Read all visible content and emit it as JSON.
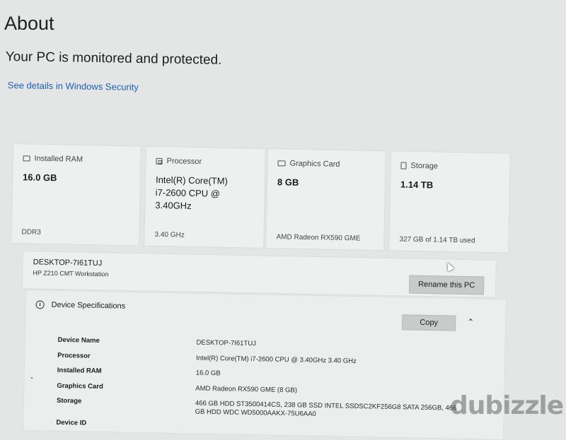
{
  "about": {
    "title": "About",
    "protection_status": "Your PC is monitored and protected.",
    "security_link": "See details in Windows Security"
  },
  "cards": {
    "ram": {
      "label": "Installed RAM",
      "value": "16.0 GB",
      "detail": "DDR3",
      "icon": "ram-icon"
    },
    "processor": {
      "label": "Processor",
      "value_lines": [
        "Intel(R) Core(TM)",
        "i7-2600 CPU @",
        "3.40GHz"
      ],
      "detail": "3.40 GHz",
      "icon": "processor-icon"
    },
    "graphics": {
      "label": "Graphics Card",
      "value": "8 GB",
      "detail": "AMD Radeon RX590 GME",
      "icon": "graphics-card-icon"
    },
    "storage": {
      "label": "Storage",
      "value": "1.14 TB",
      "detail": "327 GB of 1.14 TB used",
      "icon": "storage-icon"
    }
  },
  "device": {
    "name": "DESKTOP-7I61TUJ",
    "model": "HP Z210 CMT Workstation",
    "rename_button": "Rename this PC"
  },
  "specs": {
    "heading": "Device Specifications",
    "copy_button": "Copy",
    "rows": [
      {
        "label": "Device Name",
        "value": "DESKTOP-7I61TUJ"
      },
      {
        "label": "Processor",
        "value": "Intel(R) Core(TM) i7-2600 CPU @ 3.40GHz   3.40 GHz"
      },
      {
        "label": "Installed RAM",
        "value": "16.0 GB"
      },
      {
        "label": "Graphics Card",
        "value": "AMD Radeon RX590 GME (8 GB)"
      },
      {
        "label": "Storage",
        "value": "466 GB HDD ST3500414CS, 238 GB SSD INTEL SSDSC2KF256G8 SATA 256GB, 466 GB HDD WDC WD5000AAKX-75U6AA0"
      },
      {
        "label": "Device ID",
        "value": ""
      }
    ]
  },
  "watermark": "dubizzle"
}
